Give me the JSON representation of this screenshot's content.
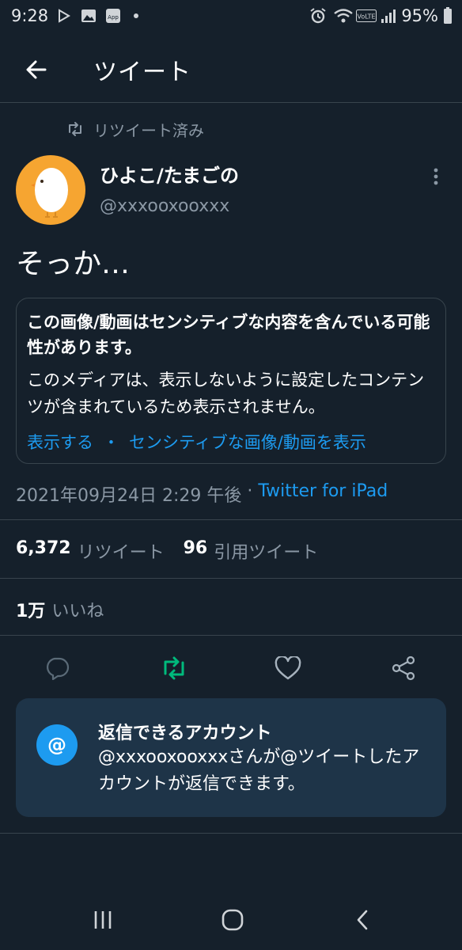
{
  "status_bar": {
    "time": "9:28",
    "battery": "95%",
    "icons": [
      "play-store-icon",
      "gallery-icon",
      "app-icon",
      "dot-icon",
      "alarm-icon",
      "wifi-icon",
      "volte-icon",
      "signal-icon",
      "battery-icon"
    ],
    "volte_label": "VoLTE",
    "app_label": "App"
  },
  "header": {
    "title": "ツイート",
    "back_icon": "arrow-left-icon"
  },
  "tweet": {
    "retweet_label": "リツイート済み",
    "display_name": "ひよこ/たまごの",
    "handle": "@xxxooxooxxx",
    "text": "そっか…",
    "sensitive": {
      "title": "この画像/動画はセンシティブな内容を含んでいる可能性があります。",
      "description": "このメディアは、表示しないように設定したコンテンツが含まれているため表示されません。",
      "show_label": "表示する",
      "separator": "・",
      "settings_label": "センシティブな画像/動画を表示"
    },
    "timestamp": "2021年09月24日 2:29 午後",
    "meta_separator": " · ",
    "source": "Twitter for iPad",
    "retweets_count": "6,372",
    "retweets_label": "リツイート",
    "quotes_count": "96",
    "quotes_label": "引用ツイート",
    "likes_count": "1万",
    "likes_label": "いいね"
  },
  "actions": [
    "reply-icon",
    "retweet-icon",
    "like-icon",
    "share-icon"
  ],
  "colors": {
    "background": "#15202b",
    "accent": "#1d9bf0",
    "retweeted": "#00ba7c",
    "muted": "#8b98a5",
    "avatar_bg": "#f6a531"
  },
  "reply_notice": {
    "icon_label": "@",
    "title": "返信できるアカウント",
    "body": "@xxxooxooxxxさんが@ツイートしたアカウントが返信できます。"
  },
  "nav_bar": {
    "buttons": [
      "recent-apps-icon",
      "home-icon",
      "back-icon"
    ]
  }
}
